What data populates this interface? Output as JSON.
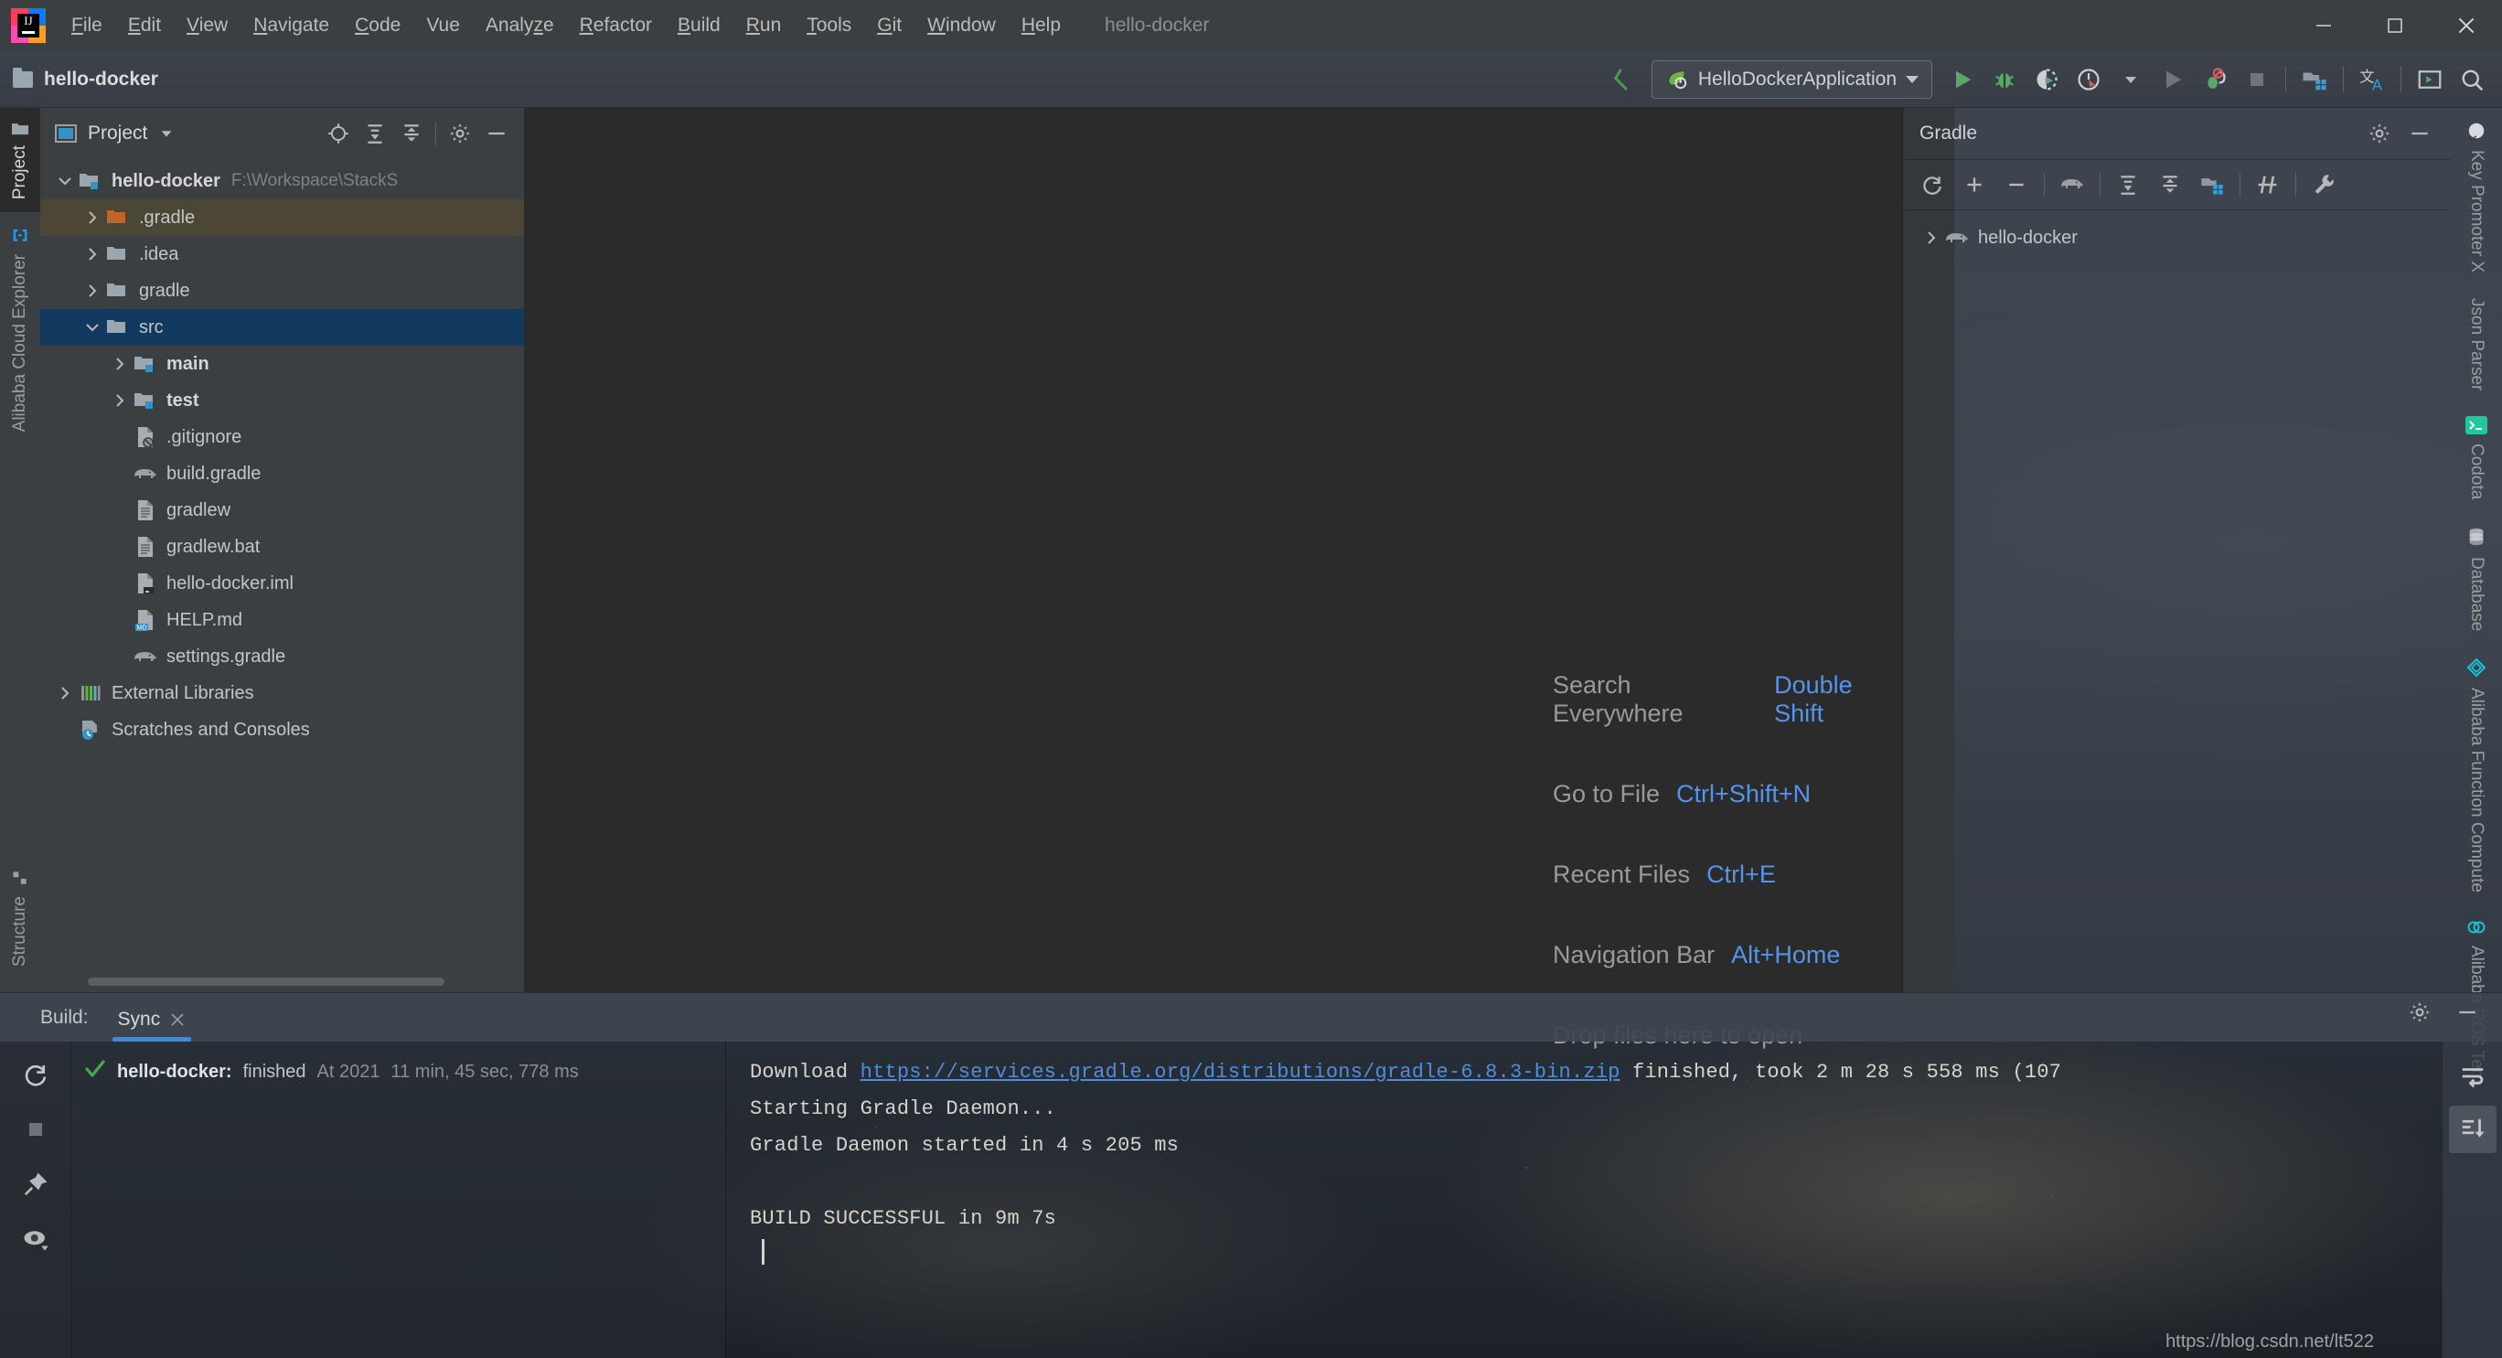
{
  "window": {
    "title": "hello-docker",
    "controls": [
      "minimize",
      "maximize",
      "close"
    ]
  },
  "menubar": {
    "logo": "intellij-idea-logo",
    "items": [
      {
        "label": "File",
        "mnemonic": "F"
      },
      {
        "label": "Edit",
        "mnemonic": "E"
      },
      {
        "label": "View",
        "mnemonic": "V"
      },
      {
        "label": "Navigate",
        "mnemonic": "N"
      },
      {
        "label": "Code",
        "mnemonic": "C"
      },
      {
        "label": "Vue",
        "mnemonic": ""
      },
      {
        "label": "Analyze",
        "mnemonic": "z"
      },
      {
        "label": "Refactor",
        "mnemonic": "R"
      },
      {
        "label": "Build",
        "mnemonic": "B"
      },
      {
        "label": "Run",
        "mnemonic": "R"
      },
      {
        "label": "Tools",
        "mnemonic": "T"
      },
      {
        "label": "Git",
        "mnemonic": "G"
      },
      {
        "label": "Window",
        "mnemonic": "W"
      },
      {
        "label": "Help",
        "mnemonic": "H"
      }
    ]
  },
  "toolbar": {
    "project_name": "hello-docker",
    "run_config": {
      "name": "HelloDockerApplication",
      "icon": "spring-boot-icon"
    },
    "icons": [
      "navigate-back-icon",
      "run-icon",
      "debug-icon",
      "run-with-coverage-icon",
      "profiler-icon",
      "chevron-down-icon",
      "run-gray-icon",
      "stop-debug-icon",
      "stop-icon",
      "build-project-icon",
      "translate-icon",
      "terminal-icon",
      "search-icon"
    ]
  },
  "left_stripe": {
    "tabs": [
      {
        "label": "Project",
        "icon": "folder-icon",
        "active": true
      },
      {
        "label": "Alibaba Cloud Explorer",
        "icon": "alibaba-cloud-icon",
        "active": false
      }
    ],
    "bottom_tabs": [
      {
        "label": "Structure",
        "icon": "structure-icon",
        "active": false
      }
    ]
  },
  "project_panel": {
    "title": "Project",
    "header_icons": [
      "locate-icon",
      "expand-all-icon",
      "collapse-all-icon",
      "gear-icon",
      "hide-icon"
    ],
    "tree": [
      {
        "label": "hello-docker",
        "path": "F:\\Workspace\\StackS",
        "icon": "module-folder-icon",
        "twisty": "down",
        "indent": 0,
        "bold": true,
        "state": "normal"
      },
      {
        "label": ".gradle",
        "icon": "excluded-folder-icon",
        "twisty": "right",
        "indent": 1,
        "bold": false,
        "state": "hover"
      },
      {
        "label": ".idea",
        "icon": "folder-icon",
        "twisty": "right",
        "indent": 1,
        "bold": false,
        "state": "normal"
      },
      {
        "label": "gradle",
        "icon": "folder-icon",
        "twisty": "right",
        "indent": 1,
        "bold": false,
        "state": "normal"
      },
      {
        "label": "src",
        "icon": "folder-icon",
        "twisty": "down",
        "indent": 1,
        "bold": false,
        "state": "selected"
      },
      {
        "label": "main",
        "icon": "source-folder-icon",
        "twisty": "right",
        "indent": 2,
        "bold": true,
        "state": "normal"
      },
      {
        "label": "test",
        "icon": "test-folder-icon",
        "twisty": "right",
        "indent": 2,
        "bold": true,
        "state": "normal"
      },
      {
        "label": ".gitignore",
        "icon": "gitignore-file-icon",
        "twisty": "none",
        "indent": 2,
        "bold": false,
        "state": "normal"
      },
      {
        "label": "build.gradle",
        "icon": "gradle-elephant-icon",
        "twisty": "none",
        "indent": 2,
        "bold": false,
        "state": "normal"
      },
      {
        "label": "gradlew",
        "icon": "script-file-icon",
        "twisty": "none",
        "indent": 2,
        "bold": false,
        "state": "normal"
      },
      {
        "label": "gradlew.bat",
        "icon": "script-file-icon",
        "twisty": "none",
        "indent": 2,
        "bold": false,
        "state": "normal"
      },
      {
        "label": "hello-docker.iml",
        "icon": "iml-file-icon",
        "twisty": "none",
        "indent": 2,
        "bold": false,
        "state": "normal"
      },
      {
        "label": "HELP.md",
        "icon": "markdown-file-icon",
        "twisty": "none",
        "indent": 2,
        "bold": false,
        "state": "normal"
      },
      {
        "label": "settings.gradle",
        "icon": "gradle-elephant-icon",
        "twisty": "none",
        "indent": 2,
        "bold": false,
        "state": "normal"
      },
      {
        "label": "External Libraries",
        "icon": "libraries-icon",
        "twisty": "right",
        "indent": 0,
        "bold": false,
        "state": "normal"
      },
      {
        "label": "Scratches and Consoles",
        "icon": "scratches-icon",
        "twisty": "none",
        "indent": 0,
        "bold": false,
        "state": "normal"
      }
    ]
  },
  "editor": {
    "hints": [
      {
        "action": "Search Everywhere",
        "shortcut": "Double Shift"
      },
      {
        "action": "Go to File",
        "shortcut": "Ctrl+Shift+N"
      },
      {
        "action": "Recent Files",
        "shortcut": "Ctrl+E"
      },
      {
        "action": "Navigation Bar",
        "shortcut": "Alt+Home"
      }
    ],
    "drop_hint": "Drop files here to open"
  },
  "gradle_panel": {
    "title": "Gradle",
    "header_icons": [
      "gear-icon",
      "hide-icon"
    ],
    "tool_icons": [
      "refresh-icon",
      "add-icon",
      "remove-icon",
      "gradle-elephant-icon",
      "expand-all-icon",
      "collapse-all-icon",
      "build-icon",
      "skip-tests-icon",
      "wrench-icon"
    ],
    "tree": [
      {
        "label": "hello-docker",
        "icon": "gradle-elephant-icon",
        "twisty": "right"
      }
    ]
  },
  "right_stripe": {
    "tabs": [
      {
        "label": "Key Promoter X",
        "icon": "key-promoter-icon"
      },
      {
        "label": "Json Parser",
        "icon": "json-parser-icon"
      },
      {
        "label": "Codota",
        "icon": "codota-terminal-icon"
      },
      {
        "label": "Database",
        "icon": "database-icon"
      },
      {
        "label": "Alibaba Function Compute",
        "icon": "alibaba-fc-icon"
      },
      {
        "label": "Alibaba ROS Tem",
        "icon": "alibaba-ros-icon"
      }
    ]
  },
  "build_panel": {
    "label": "Build:",
    "tab": {
      "label": "Sync",
      "close": "close-icon"
    },
    "side_icons": [
      "rerun-icon",
      "stop-icon",
      "pin-icon",
      "eye-icon"
    ],
    "header_icons": [
      "gear-icon",
      "hide-icon"
    ],
    "tree": [
      {
        "status_icon": "success-check-icon",
        "name": "hello-docker:",
        "status": "finished",
        "timestamp": "At 2021",
        "duration": "11 min, 45 sec, 778 ms"
      }
    ],
    "console": {
      "lines": [
        {
          "prefix": "Download ",
          "link": "https://services.gradle.org/distributions/gradle-6.8.3-bin.zip",
          "suffix": " finished, took 2 m 28 s 558 ms (107"
        },
        {
          "text": "Starting Gradle Daemon..."
        },
        {
          "text": "Gradle Daemon started in 4 s 205 ms"
        },
        {
          "text": ""
        },
        {
          "text": "BUILD SUCCESSFUL in 9m 7s"
        },
        {
          "text": "",
          "caret": true
        }
      ]
    },
    "console_tools": [
      "soft-wrap-icon",
      "scroll-to-end-icon"
    ]
  },
  "watermark": "https://blog.csdn.net/lt522",
  "colors": {
    "accent_blue": "#5394ec",
    "selection_blue": "#123a5e",
    "tab_underline": "#4a88c7",
    "link_blue": "#4f8ddc",
    "success_green": "#4aa84a",
    "panel_bg": "#3c3f41",
    "editor_bg": "#2b2b2b",
    "excluded_orange": "#c1642c"
  }
}
